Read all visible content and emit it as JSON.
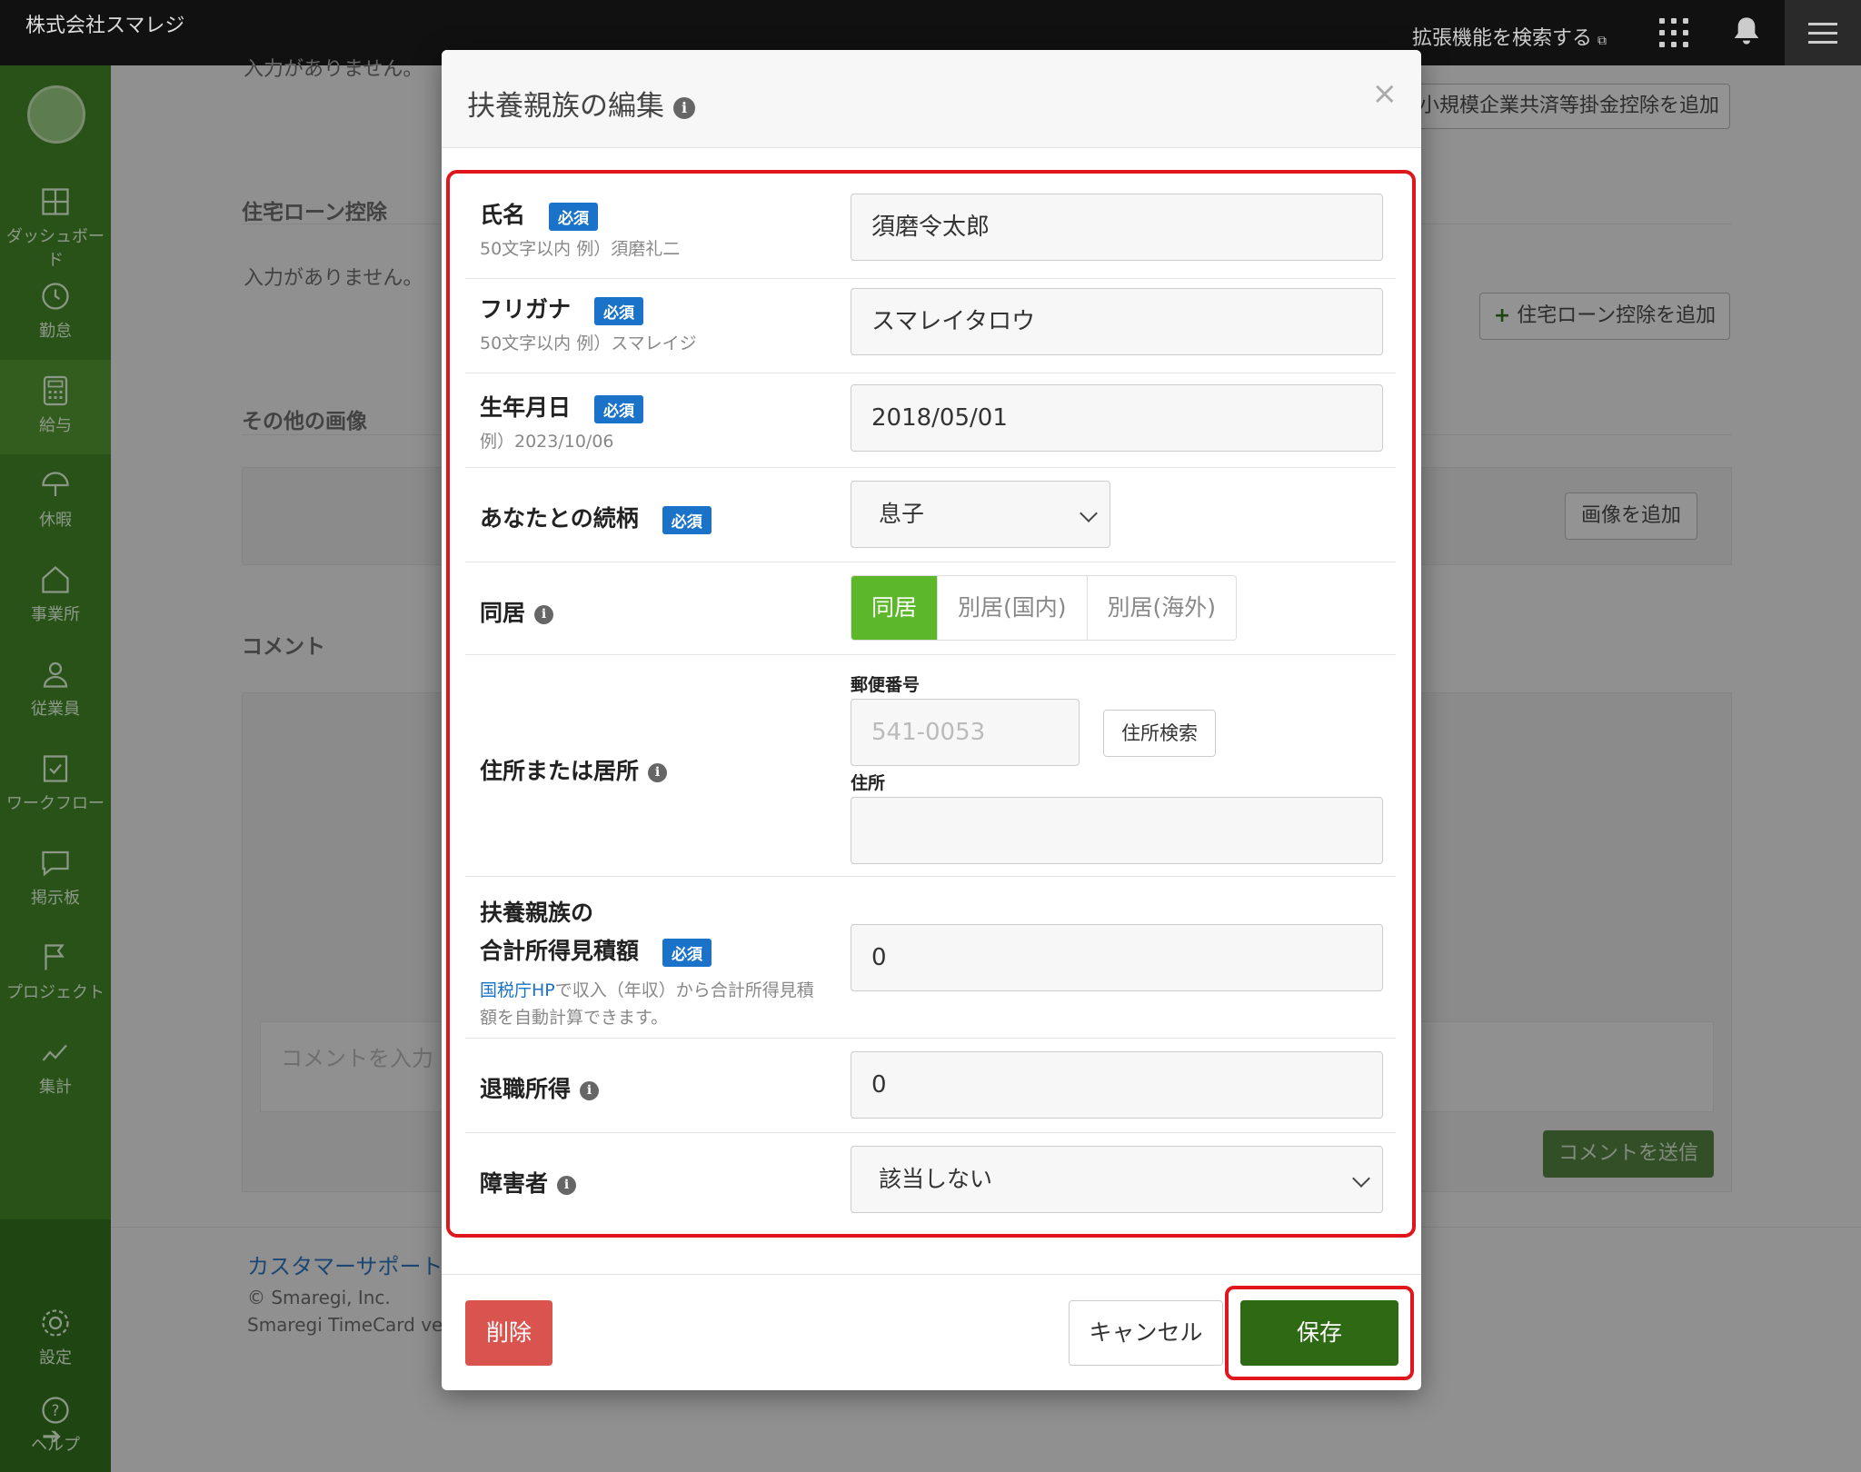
{
  "topbar": {
    "company": "株式会社スマレジ",
    "extension_search": "拡張機能を検索する",
    "external_icon": "external-link-icon",
    "apps_icon": "grid-icon",
    "bell_icon": "bell-icon",
    "menu_icon": "hamburger-icon"
  },
  "sidebar": {
    "items": [
      {
        "label": "ダッシュボード",
        "icon": "dashboard-icon"
      },
      {
        "label": "勤怠",
        "icon": "clock-icon"
      },
      {
        "label": "給与",
        "icon": "calculator-icon"
      },
      {
        "label": "休暇",
        "icon": "umbrella-icon"
      },
      {
        "label": "事業所",
        "icon": "home-icon"
      },
      {
        "label": "従業員",
        "icon": "user-icon"
      },
      {
        "label": "ワークフロー",
        "icon": "checklist-icon"
      },
      {
        "label": "掲示板",
        "icon": "chat-icon"
      },
      {
        "label": "プロジェクト",
        "icon": "flag-icon"
      },
      {
        "label": "集計",
        "icon": "chart-line-icon"
      }
    ],
    "bottom": [
      {
        "label": "設定",
        "icon": "gear-icon"
      },
      {
        "label": "ヘルプ",
        "icon": "help-icon"
      }
    ],
    "expand_icon": "arrow-right-icon"
  },
  "background": {
    "top_partial": "入力がありません。",
    "small_business_button": "小規模企業共済等掛金控除を追加",
    "housing_loan_heading": "住宅ローン控除",
    "housing_loan_empty": "入力がありません。",
    "housing_loan_button": "住宅ローン控除を追加",
    "other_images_heading": "その他の画像",
    "add_image_button": "画像を追加",
    "comment_heading": "コメント",
    "comment_placeholder": "コメントを入力",
    "send_comment_button": "コメントを送信",
    "customer_support": "カスタマーサポート",
    "copyright": "© Smaregi, Inc.",
    "version": "Smaregi TimeCard ve"
  },
  "modal": {
    "title": "扶養親族の編集",
    "close": "×",
    "required_badge": "必須",
    "fields": {
      "name": {
        "label": "氏名",
        "hint": "50文字以内 例）須磨礼二",
        "value": "須磨令太郎"
      },
      "furigana": {
        "label": "フリガナ",
        "hint": "50文字以内 例）スマレイジ",
        "value": "スマレイタロウ"
      },
      "birthdate": {
        "label": "生年月日",
        "hint": "例）2023/10/06",
        "value": "2018/05/01"
      },
      "relationship": {
        "label": "あなたとの続柄",
        "value": "息子"
      },
      "cohabit": {
        "label": "同居",
        "options": [
          "同居",
          "別居(国内)",
          "別居(海外)"
        ],
        "selected": "同居"
      },
      "address": {
        "label": "住所または居所",
        "postal_label": "郵便番号",
        "postal_placeholder": "541-0053",
        "search_button": "住所検索",
        "address_label": "住所",
        "address_value": ""
      },
      "income": {
        "label_line1": "扶養親族の",
        "label_line2": "合計所得見積額",
        "hint_link": "国税庁HP",
        "hint_text1": "で収入（年収）から合計所得見積",
        "hint_text2": "額を自動計算できます。",
        "value": "0"
      },
      "retirement_income": {
        "label": "退職所得",
        "value": "0"
      },
      "disability": {
        "label": "障害者",
        "value": "該当しない"
      }
    },
    "footer": {
      "delete": "削除",
      "cancel": "キャンセル",
      "save": "保存"
    }
  },
  "colors": {
    "sidebar": "#3f7f26",
    "primary_green": "#2e6a13",
    "segment_on": "#5cb82a",
    "badge_blue": "#1a73c8",
    "delete_red": "#d9534f",
    "highlight_red": "#e0161d"
  }
}
